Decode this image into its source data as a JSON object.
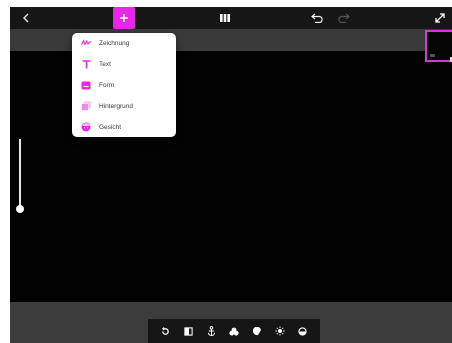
{
  "colors": {
    "accent": "#e826e8",
    "topbar": "#161616",
    "canvas": "#030303",
    "panel": "#4a4a4a"
  },
  "topbar": {
    "back_icon": "chevron-left-icon",
    "add_icon": "plus-icon",
    "panels_icon": "panels-icon",
    "undo_icon": "undo-icon",
    "redo_icon": "redo-icon",
    "expand_icon": "expand-icon"
  },
  "add_menu": {
    "items": [
      {
        "label": "Zeichnung",
        "icon": "drawing-icon"
      },
      {
        "label": "Text",
        "icon": "text-icon"
      },
      {
        "label": "Form",
        "icon": "shape-icon"
      },
      {
        "label": "Hintergrund",
        "icon": "background-icon"
      },
      {
        "label": "Gesicht",
        "icon": "face-icon"
      }
    ]
  },
  "toolbar": {
    "tools": [
      "rotate-icon",
      "flip-icon",
      "anchor-icon",
      "layers-icon",
      "brush-icon",
      "brightness-icon",
      "color-icon"
    ]
  }
}
